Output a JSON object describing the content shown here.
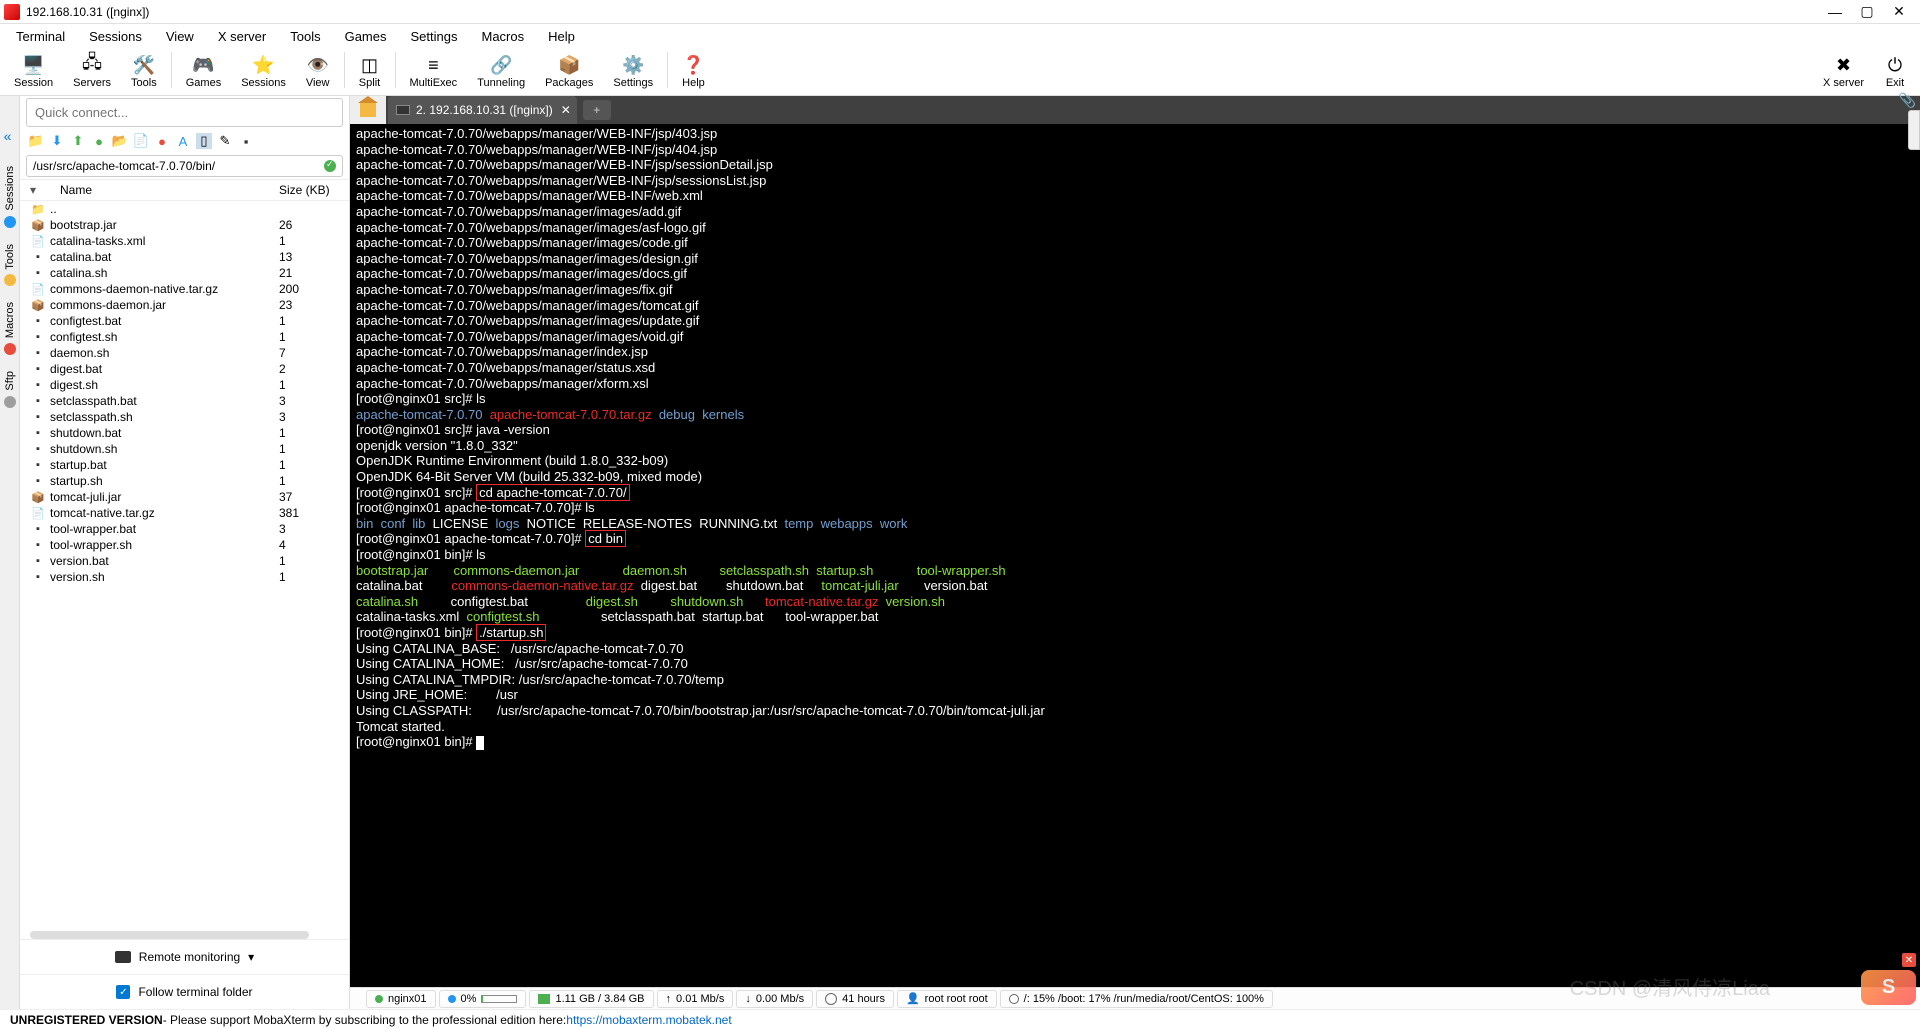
{
  "window": {
    "title": "192.168.10.31 ([nginx])"
  },
  "menubar": [
    "Terminal",
    "Sessions",
    "View",
    "X server",
    "Tools",
    "Games",
    "Settings",
    "Macros",
    "Help"
  ],
  "toolbar": [
    {
      "label": "Session",
      "icon": "🖥️"
    },
    {
      "label": "Servers",
      "icon": "🖧"
    },
    {
      "label": "Tools",
      "icon": "🛠️"
    },
    {
      "label": "Games",
      "icon": "🎮"
    },
    {
      "label": "Sessions",
      "icon": "⭐"
    },
    {
      "label": "View",
      "icon": "👁️"
    },
    {
      "label": "Split",
      "icon": "◫"
    },
    {
      "label": "MultiExec",
      "icon": "≡"
    },
    {
      "label": "Tunneling",
      "icon": "🔗"
    },
    {
      "label": "Packages",
      "icon": "📦"
    },
    {
      "label": "Settings",
      "icon": "⚙️"
    },
    {
      "label": "Help",
      "icon": "❓"
    }
  ],
  "toolbar_right": [
    {
      "label": "X server",
      "icon": "✖"
    },
    {
      "label": "Exit",
      "icon": "⏻"
    }
  ],
  "quick_connect_placeholder": "Quick connect...",
  "leftbar": [
    "Sessions",
    "Tools",
    "Macros",
    "Sftp"
  ],
  "sftp_path": "/usr/src/apache-tomcat-7.0.70/bin/",
  "file_headers": {
    "name": "Name",
    "size": "Size (KB)"
  },
  "files": [
    {
      "name": "..",
      "size": "",
      "icon": "folder"
    },
    {
      "name": "bootstrap.jar",
      "size": "26",
      "icon": "jar"
    },
    {
      "name": "catalina-tasks.xml",
      "size": "1",
      "icon": "xml"
    },
    {
      "name": "catalina.bat",
      "size": "13",
      "icon": "bat"
    },
    {
      "name": "catalina.sh",
      "size": "21",
      "icon": "sh"
    },
    {
      "name": "commons-daemon-native.tar.gz",
      "size": "200",
      "icon": "gz"
    },
    {
      "name": "commons-daemon.jar",
      "size": "23",
      "icon": "jar"
    },
    {
      "name": "configtest.bat",
      "size": "1",
      "icon": "bat"
    },
    {
      "name": "configtest.sh",
      "size": "1",
      "icon": "sh"
    },
    {
      "name": "daemon.sh",
      "size": "7",
      "icon": "sh"
    },
    {
      "name": "digest.bat",
      "size": "2",
      "icon": "bat"
    },
    {
      "name": "digest.sh",
      "size": "1",
      "icon": "sh"
    },
    {
      "name": "setclasspath.bat",
      "size": "3",
      "icon": "bat"
    },
    {
      "name": "setclasspath.sh",
      "size": "3",
      "icon": "sh"
    },
    {
      "name": "shutdown.bat",
      "size": "1",
      "icon": "bat"
    },
    {
      "name": "shutdown.sh",
      "size": "1",
      "icon": "sh"
    },
    {
      "name": "startup.bat",
      "size": "1",
      "icon": "bat"
    },
    {
      "name": "startup.sh",
      "size": "1",
      "icon": "sh"
    },
    {
      "name": "tomcat-juli.jar",
      "size": "37",
      "icon": "jar"
    },
    {
      "name": "tomcat-native.tar.gz",
      "size": "381",
      "icon": "gz"
    },
    {
      "name": "tool-wrapper.bat",
      "size": "3",
      "icon": "bat"
    },
    {
      "name": "tool-wrapper.sh",
      "size": "4",
      "icon": "sh"
    },
    {
      "name": "version.bat",
      "size": "1",
      "icon": "bat"
    },
    {
      "name": "version.sh",
      "size": "1",
      "icon": "sh"
    }
  ],
  "remote_monitoring": "Remote monitoring",
  "follow_terminal": "Follow terminal folder",
  "tab": {
    "title": "2. 192.168.10.31 ([nginx])"
  },
  "terminal_initial_lines": [
    "apache-tomcat-7.0.70/webapps/manager/WEB-INF/jsp/403.jsp",
    "apache-tomcat-7.0.70/webapps/manager/WEB-INF/jsp/404.jsp",
    "apache-tomcat-7.0.70/webapps/manager/WEB-INF/jsp/sessionDetail.jsp",
    "apache-tomcat-7.0.70/webapps/manager/WEB-INF/jsp/sessionsList.jsp",
    "apache-tomcat-7.0.70/webapps/manager/WEB-INF/web.xml",
    "apache-tomcat-7.0.70/webapps/manager/images/add.gif",
    "apache-tomcat-7.0.70/webapps/manager/images/asf-logo.gif",
    "apache-tomcat-7.0.70/webapps/manager/images/code.gif",
    "apache-tomcat-7.0.70/webapps/manager/images/design.gif",
    "apache-tomcat-7.0.70/webapps/manager/images/docs.gif",
    "apache-tomcat-7.0.70/webapps/manager/images/fix.gif",
    "apache-tomcat-7.0.70/webapps/manager/images/tomcat.gif",
    "apache-tomcat-7.0.70/webapps/manager/images/update.gif",
    "apache-tomcat-7.0.70/webapps/manager/images/void.gif",
    "apache-tomcat-7.0.70/webapps/manager/index.jsp",
    "apache-tomcat-7.0.70/webapps/manager/status.xsd",
    "apache-tomcat-7.0.70/webapps/manager/xform.xsl"
  ],
  "prompts": {
    "src": "[root@nginx01 src]#",
    "tomcat": "[root@nginx01 apache-tomcat-7.0.70]#",
    "bin": "[root@nginx01 bin]#"
  },
  "commands": {
    "ls": "ls",
    "java_ver": "java -version",
    "cd_tomcat": "cd apache-tomcat-7.0.70/",
    "cd_bin": "cd bin",
    "startup": "./startup.sh"
  },
  "src_ls": {
    "a": "apache-tomcat-7.0.70",
    "b": "apache-tomcat-7.0.70.tar.gz",
    "c": "debug",
    "d": "kernels"
  },
  "java_out": [
    "openjdk version \"1.8.0_332\"",
    "OpenJDK Runtime Environment (build 1.8.0_332-b09)",
    "OpenJDK 64-Bit Server VM (build 25.332-b09, mixed mode)"
  ],
  "tomcat_ls": {
    "bin": "bin",
    "conf": "conf",
    "lib": "lib",
    "license": "LICENSE",
    "logs": "logs",
    "notice": "NOTICE",
    "release": "RELEASE-NOTES",
    "running": "RUNNING.txt",
    "temp": "temp",
    "webapps": "webapps",
    "work": "work"
  },
  "bin_ls": {
    "r1c1": "bootstrap.jar",
    "r1c2": "commons-daemon.jar",
    "r1c3": "daemon.sh",
    "r1c4": "setclasspath.sh",
    "r1c5": "startup.sh",
    "r1c6": "tool-wrapper.sh",
    "r2c1": "catalina.bat",
    "r2c2": "commons-daemon-native.tar.gz",
    "r2c3": "digest.bat",
    "r2c4": "shutdown.bat",
    "r2c5": "tomcat-juli.jar",
    "r2c6": "version.bat",
    "r3c1": "catalina.sh",
    "r3c2": "configtest.bat",
    "r3c3": "digest.sh",
    "r3c4": "shutdown.sh",
    "r3c5": "tomcat-native.tar.gz",
    "r3c6": "version.sh",
    "r4c1": "catalina-tasks.xml",
    "r4c2": "configtest.sh",
    "r4c3": "setclasspath.bat",
    "r4c4": "startup.bat",
    "r4c5": "tool-wrapper.bat"
  },
  "startup_out": [
    "Using CATALINA_BASE:   /usr/src/apache-tomcat-7.0.70",
    "Using CATALINA_HOME:   /usr/src/apache-tomcat-7.0.70",
    "Using CATALINA_TMPDIR: /usr/src/apache-tomcat-7.0.70/temp",
    "Using JRE_HOME:        /usr",
    "Using CLASSPATH:       /usr/src/apache-tomcat-7.0.70/bin/bootstrap.jar:/usr/src/apache-tomcat-7.0.70/bin/tomcat-juli.jar",
    "Tomcat started."
  ],
  "status": {
    "host": "nginx01",
    "cpu": "0%",
    "mem": "1.11 GB / 3.84 GB",
    "up": "0.01 Mb/s",
    "down": "0.00 Mb/s",
    "uptime": "41 hours",
    "user": "root  root  root",
    "disks": "/: 15%   /boot: 17%   /run/media/root/CentOS: 100%"
  },
  "footer": {
    "unreg": "UNREGISTERED VERSION",
    "text": "  -  Please support MobaXterm by subscribing to the professional edition here:  ",
    "link": "https://mobaxterm.mobatek.net"
  },
  "watermark": "CSDN @清风侍凉Liaa"
}
